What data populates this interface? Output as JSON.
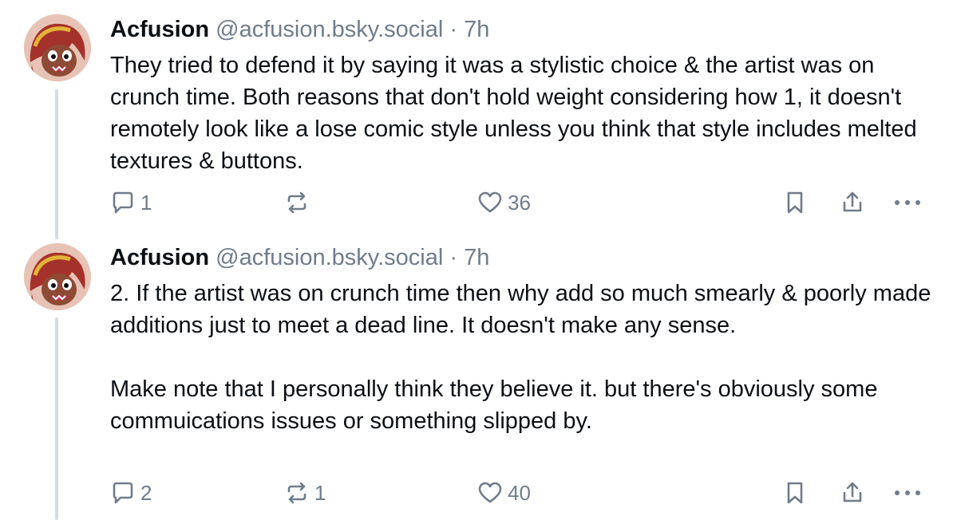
{
  "posts": [
    {
      "author": "Acfusion",
      "handle": "@acfusion.bsky.social",
      "separator": "·",
      "time": "7h",
      "text": "They tried to defend it by saying it was a stylistic choice & the artist was on crunch time. Both reasons that don't hold weight considering how 1, it doesn't remotely look like a lose comic style unless you think that style includes melted textures & buttons.",
      "replies": "1",
      "reposts": "",
      "likes": "36"
    },
    {
      "author": "Acfusion",
      "handle": "@acfusion.bsky.social",
      "separator": "·",
      "time": "7h",
      "text": "2. If the artist was on crunch time then why add so much smearly & poorly made additions just to meet a dead line. It doesn't make any sense.\n\nMake note that I personally think they believe it. but there's obviously some commuications issues or something slipped by.",
      "replies": "2",
      "reposts": "1",
      "likes": "40"
    }
  ],
  "icons": {
    "reply": "speech-bubble-icon",
    "repost": "repost-arrows-icon",
    "like": "heart-icon",
    "bookmark": "bookmark-icon",
    "share": "share-icon",
    "more": "more-dots-icon"
  },
  "colors": {
    "text": "#0b0f14",
    "muted": "#6f7c8c",
    "thread_line": "#d4dbe2"
  }
}
